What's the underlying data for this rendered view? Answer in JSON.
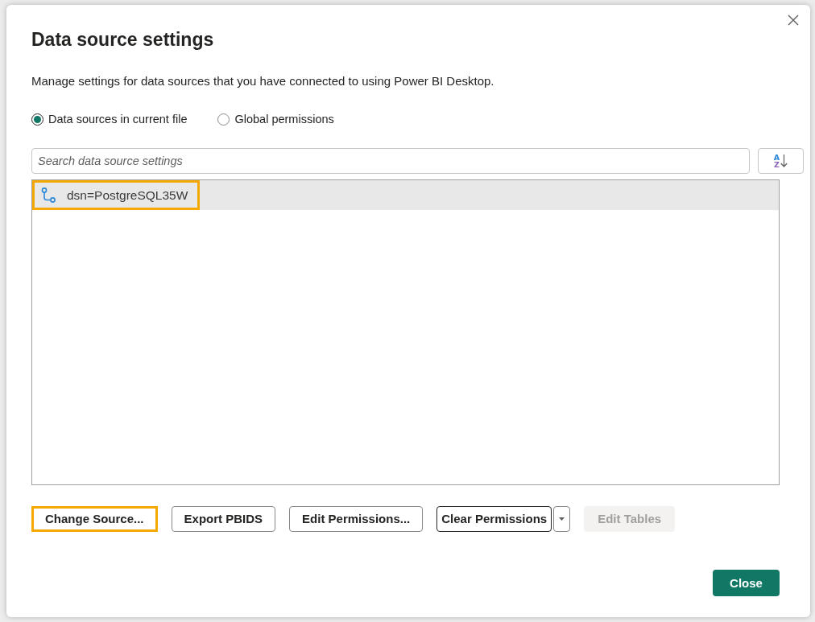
{
  "dialog": {
    "title": "Data source settings"
  },
  "description": "Manage settings for data sources that you have connected to using Power BI Desktop.",
  "scope_options": [
    {
      "label": "Data sources in current file",
      "selected": true
    },
    {
      "label": "Global permissions",
      "selected": false
    }
  ],
  "search": {
    "placeholder": "Search data source settings"
  },
  "sort_button": {
    "letters": [
      "A",
      "Z"
    ]
  },
  "data_sources": [
    {
      "name": "dsn=PostgreSQL35W",
      "selected": true,
      "highlighted": true
    }
  ],
  "actions": [
    {
      "label": "Change Source...",
      "kind": "button",
      "disabled": false,
      "highlighted": true,
      "focused": false
    },
    {
      "label": "Export PBIDS",
      "kind": "button",
      "disabled": false,
      "highlighted": false,
      "focused": false
    },
    {
      "label": "Edit Permissions...",
      "kind": "button",
      "disabled": false,
      "highlighted": false,
      "focused": false
    },
    {
      "label": "Clear Permissions",
      "kind": "split",
      "disabled": false,
      "highlighted": false,
      "focused": true
    },
    {
      "label": "Edit Tables",
      "kind": "button",
      "disabled": true,
      "highlighted": false,
      "focused": false
    }
  ],
  "footer": {
    "close_button": "Close"
  }
}
